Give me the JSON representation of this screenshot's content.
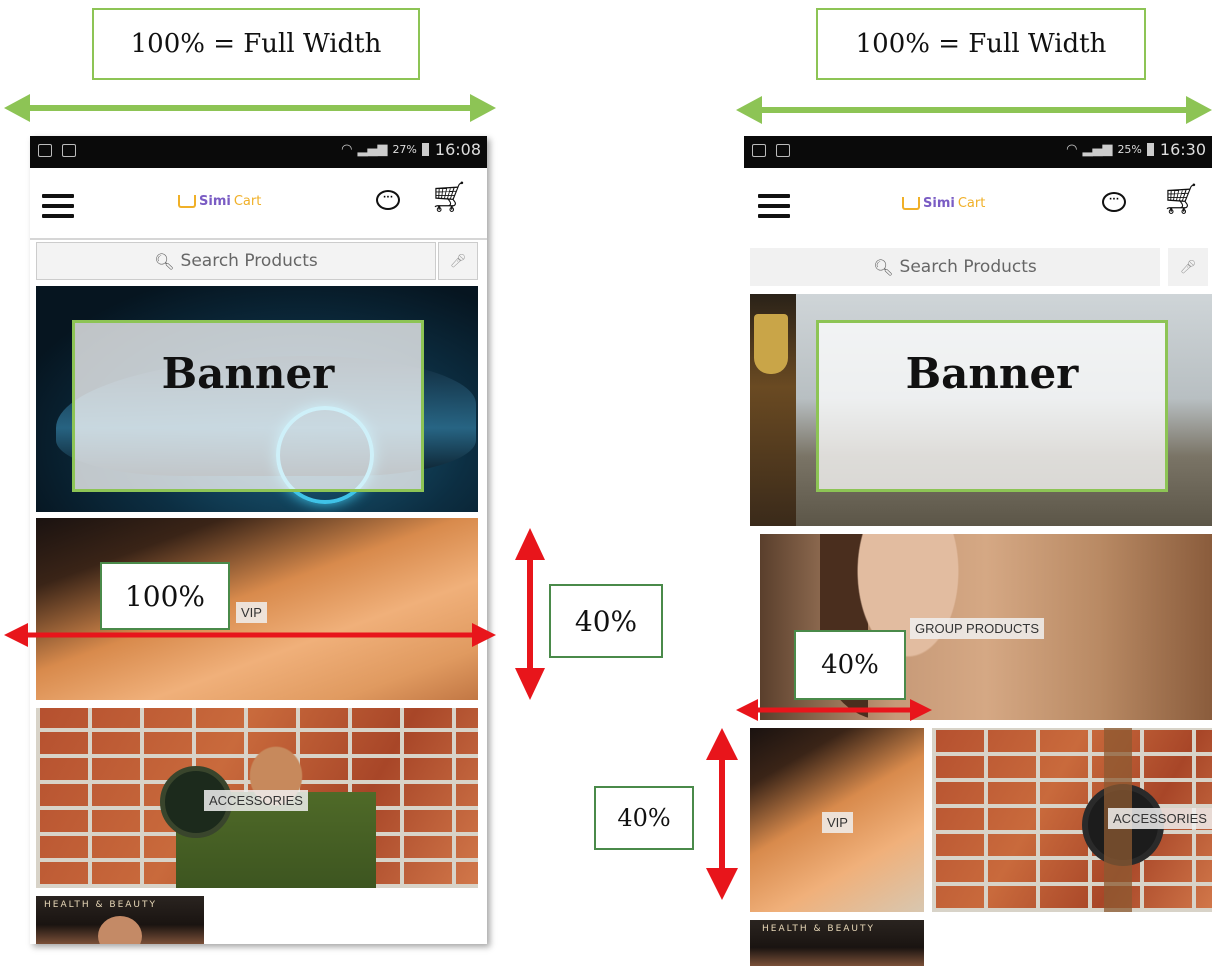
{
  "annotations": {
    "full_width_label": "100% = Full Width",
    "banner_label": "Banner",
    "percent_100": "100%",
    "percent_40": "40%"
  },
  "status_left": {
    "battery": "27%",
    "time": "16:08"
  },
  "status_right": {
    "battery": "25%",
    "time": "16:30"
  },
  "app": {
    "logo_text_a": "Simi",
    "logo_text_b": "Cart",
    "search_placeholder": "Search Products",
    "chat_glyph": "···"
  },
  "categories": {
    "vip": "VIP",
    "accessories": "ACCESSORIES",
    "group_products": "GROUP PRODUCTS",
    "health_beauty": "HEALTH & BEAUTY"
  },
  "colors": {
    "annotation_green": "#8dc455",
    "annotation_dark_green": "#4a8a4a",
    "arrow_red": "#e8151b",
    "logo_orange": "#f0b028"
  },
  "icons": [
    "menu-icon",
    "chat-icon",
    "cart-icon",
    "search-icon",
    "mic-icon",
    "wifi-icon",
    "signal-icon",
    "battery-icon"
  ]
}
